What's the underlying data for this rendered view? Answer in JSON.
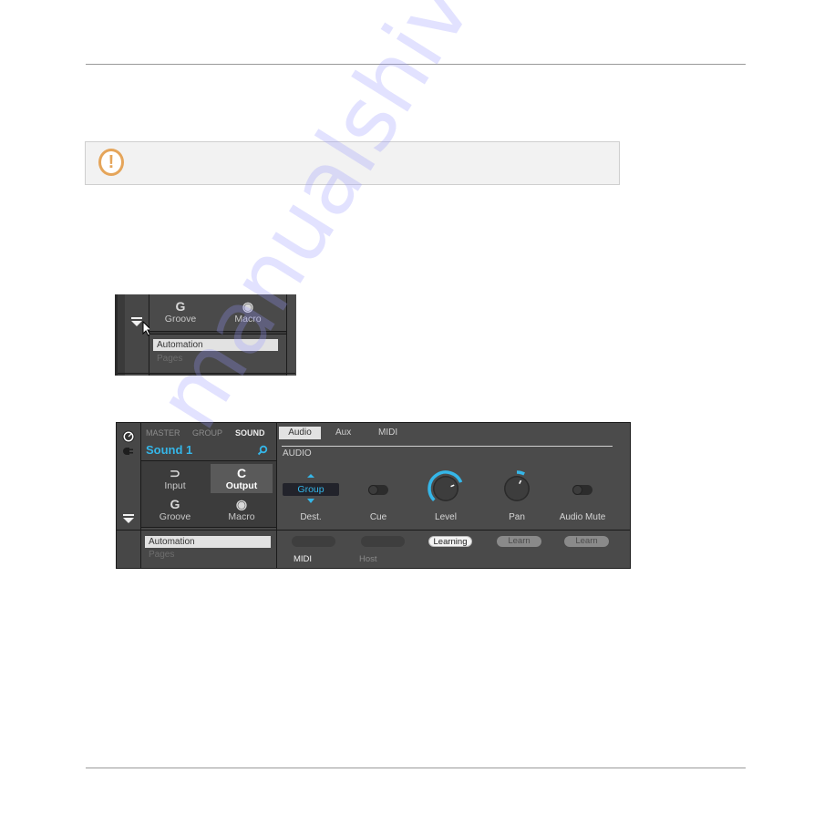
{
  "page": {
    "watermark": "manualshive.com"
  },
  "note": {
    "icon": "warning-exclamation-icon",
    "symbol": "!"
  },
  "screenshot1": {
    "modules": [
      {
        "icon": "groove-icon",
        "glyph": "G",
        "label": "Groove"
      },
      {
        "icon": "macro-icon",
        "glyph": "◉",
        "label": "Macro"
      }
    ],
    "list": {
      "selected": "Automation",
      "other": "Pages"
    }
  },
  "screenshot2": {
    "header": {
      "tabs": [
        "MASTER",
        "GROUP",
        "SOUND"
      ],
      "active_tab": "SOUND",
      "name": "Sound 1"
    },
    "modules": [
      {
        "icon": "input-icon",
        "glyph": "⊃",
        "label": "Input"
      },
      {
        "icon": "output-icon",
        "glyph": "C",
        "label": "Output",
        "selected": true
      },
      {
        "icon": "groove-icon",
        "glyph": "G",
        "label": "Groove"
      },
      {
        "icon": "macro-icon",
        "glyph": "◉",
        "label": "Macro"
      }
    ],
    "list": {
      "selected": "Automation",
      "other": "Pages"
    },
    "page_tabs": [
      "Audio",
      "Aux",
      "MIDI"
    ],
    "active_page_tab": "Audio",
    "section_title": "AUDIO",
    "controls": {
      "dest": {
        "label": "Dest.",
        "value": "Group"
      },
      "cue": {
        "label": "Cue",
        "state": "off"
      },
      "level": {
        "label": "Level",
        "value_fraction": 0.75
      },
      "pan": {
        "label": "Pan",
        "value_fraction": 0.6
      },
      "audio_mute": {
        "label": "Audio Mute",
        "state": "off"
      }
    },
    "learn_row": {
      "buttons": [
        "",
        "",
        "Learning",
        "Learn",
        "Learn"
      ],
      "mode_labels": [
        "MIDI",
        "Host"
      ],
      "active_mode": "MIDI"
    },
    "accent_color": "#35b6e8"
  }
}
